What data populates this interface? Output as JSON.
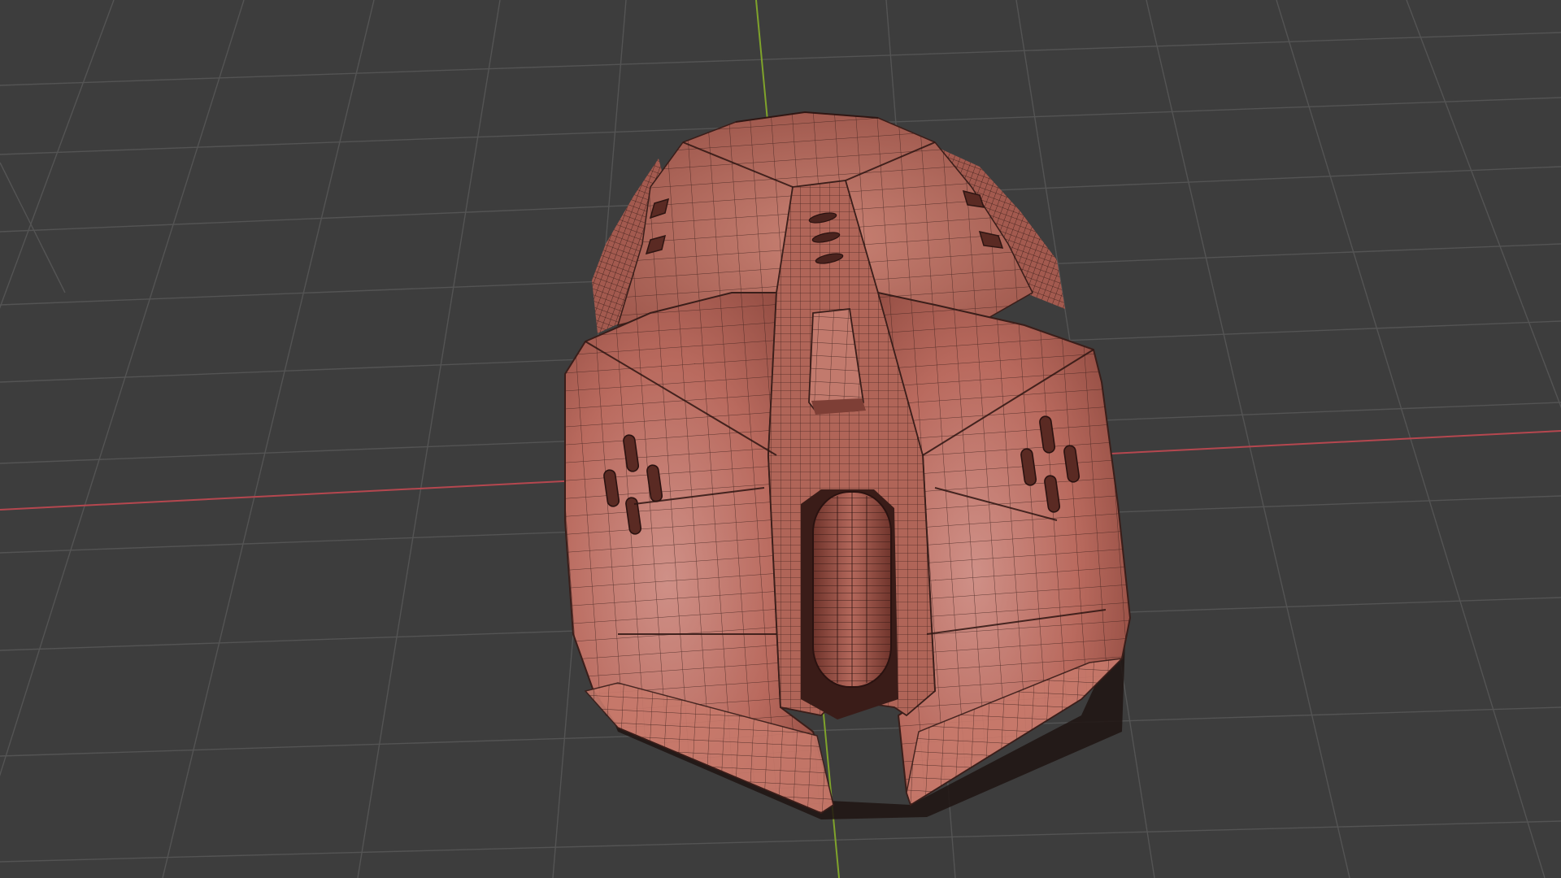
{
  "viewport": {
    "mode": "3d-viewport",
    "shading": "solid-with-wireframe-overlay",
    "object_name": "",
    "object_kind": "computer-mouse-mesh"
  },
  "colors": {
    "background": "#3d3d3d",
    "grid_line": "#545454",
    "x_axis": "#b5474f",
    "y_axis": "#7fa32b",
    "mesh_fill": "#b96a5e",
    "mesh_highlight": "#cf8d80",
    "mesh_shadow": "#7e3f36",
    "wire": "#3a1e1a"
  },
  "icons": {
    "mesh": "mouse-mesh-icon"
  }
}
